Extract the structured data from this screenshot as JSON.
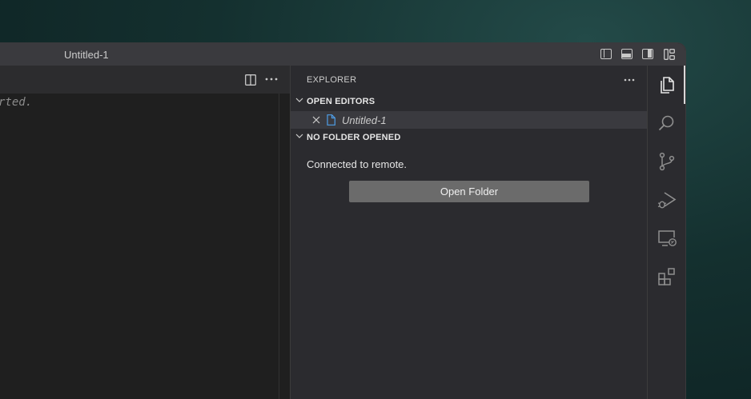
{
  "window": {
    "title": "Untitled-1"
  },
  "editor": {
    "visible_text": "rted."
  },
  "explorer": {
    "header": "EXPLORER",
    "open_editors": {
      "label": "OPEN EDITORS",
      "items": [
        {
          "name": "Untitled-1"
        }
      ]
    },
    "no_folder": {
      "label": "NO FOLDER OPENED",
      "message": "Connected to remote.",
      "button": "Open Folder"
    }
  },
  "activity_bar": {
    "items": [
      {
        "icon": "explorer-icon",
        "active": true
      },
      {
        "icon": "search-icon",
        "active": false
      },
      {
        "icon": "source-control-icon",
        "active": false
      },
      {
        "icon": "run-debug-icon",
        "active": false
      },
      {
        "icon": "remote-explorer-icon",
        "active": false
      },
      {
        "icon": "extensions-icon",
        "active": false
      }
    ]
  },
  "colors": {
    "accent_file": "#4f9ee8",
    "button_bg": "#6b6b6b"
  }
}
